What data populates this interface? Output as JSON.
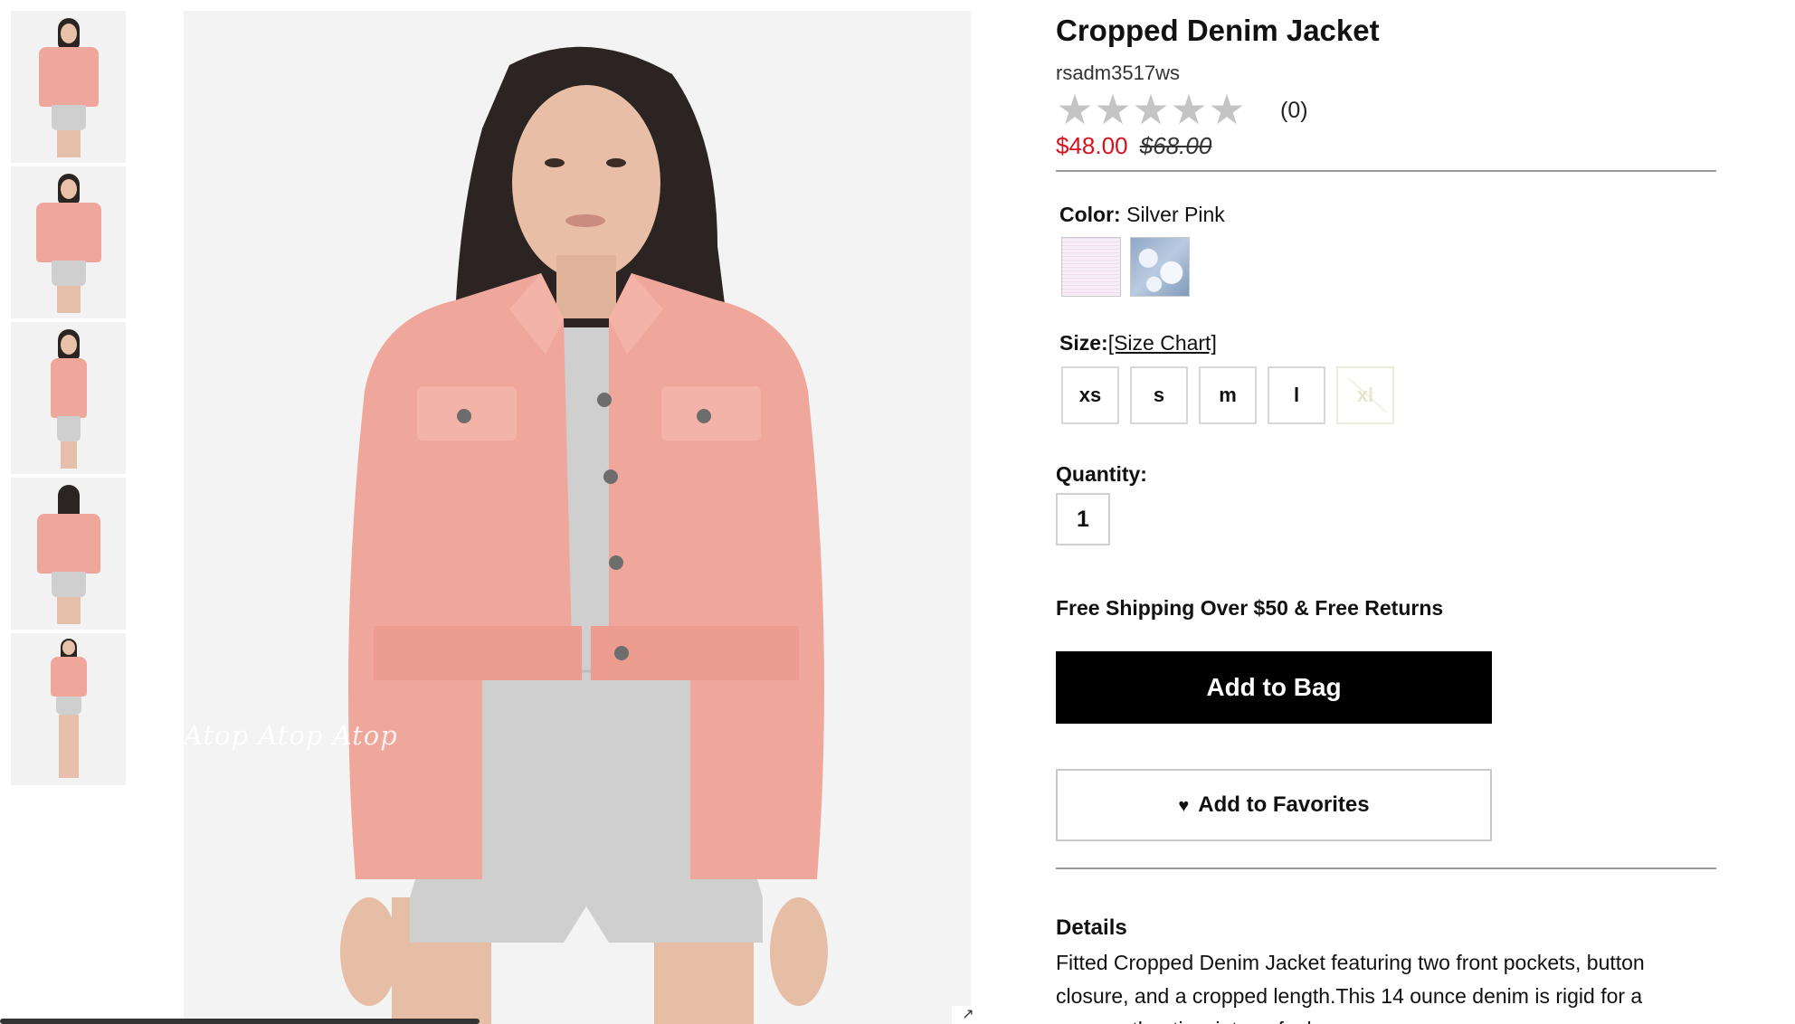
{
  "product": {
    "title": "Cropped Denim Jacket",
    "sku": "rsadm3517ws",
    "rating": {
      "stars_filled": 0,
      "stars_total": 5,
      "count": "(0)"
    },
    "sale_price": "$48.00",
    "original_price": "$68.00"
  },
  "color": {
    "label": "Color:",
    "selected": "Silver Pink",
    "swatches": [
      {
        "name": "silver-pink",
        "hex": "#f4e1f1"
      },
      {
        "name": "acid-wash-blue",
        "hex": "#a9bdd6"
      }
    ]
  },
  "size": {
    "label": "Size:",
    "chart_link": "[Size Chart]",
    "options": [
      {
        "label": "xs",
        "available": true
      },
      {
        "label": "s",
        "available": true
      },
      {
        "label": "m",
        "available": true
      },
      {
        "label": "l",
        "available": true
      },
      {
        "label": "xl",
        "available": false
      }
    ]
  },
  "quantity": {
    "label": "Quantity:",
    "value": "1"
  },
  "shipping_note": "Free Shipping Over $50 & Free Returns",
  "buttons": {
    "add_to_bag": "Add to Bag",
    "add_to_favorites": "Add to Favorites"
  },
  "details": {
    "title": "Details",
    "text": "Fitted Cropped Denim Jacket featuring two front pockets, button closure, and a cropped length.This 14 ounce denim is rigid for a more authentic, vintage feel."
  },
  "gallery": {
    "thumbnail_count": 5,
    "watermark": "Atop Atop Atop"
  },
  "colors": {
    "sale_red": "#d5121f",
    "jacket_pink": "#f0a79b",
    "button_black": "#000000"
  }
}
